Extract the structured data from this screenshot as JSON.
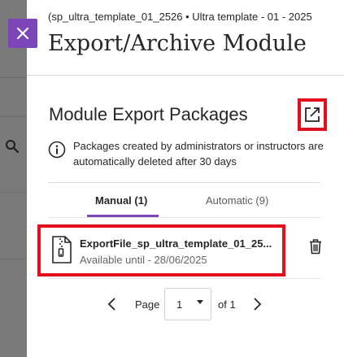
{
  "header": {
    "breadcrumb": "(sp_ultra_template_01_2526 • Ultra template - 01 - 2025",
    "title": "Export/Archive Module"
  },
  "close_button": {
    "icon": "close-icon"
  },
  "section": {
    "title": "Module Export Packages",
    "open_icon": "open-in-new-icon",
    "info_icon": "info-icon",
    "info_text": "Packages created by administrators or instructors are automatically deleted after 30 days"
  },
  "tabs": [
    {
      "label": "Manual (1)",
      "selected": true
    },
    {
      "label": "Automatic (9)",
      "selected": false
    }
  ],
  "files": [
    {
      "name": "ExportFile_sp_ultra_template_01_25...",
      "available": "Available until - 28/06/2025",
      "icon": "zip-file-icon",
      "delete_icon": "trash-icon"
    }
  ],
  "pagination": {
    "page_label": "Page",
    "current_page": "1",
    "of_label": "of 1",
    "prev_icon": "chevron-left-icon",
    "next_icon": "chevron-right-icon"
  },
  "colors": {
    "accent": "#7c45b8",
    "highlight": "#e3101b",
    "overlay": "#7a7a7a"
  }
}
